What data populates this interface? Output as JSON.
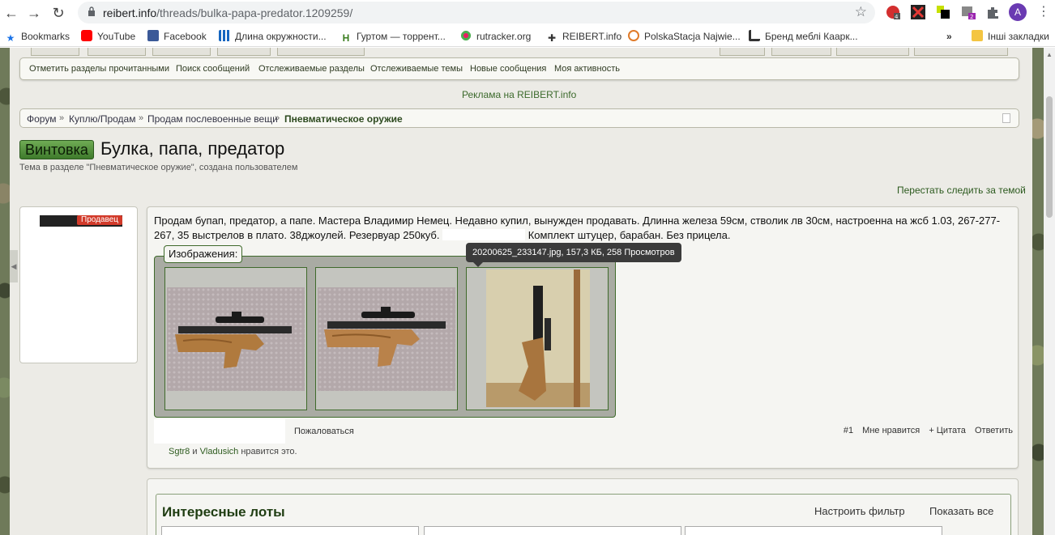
{
  "browser": {
    "url_host": "reibert.info",
    "url_path": "/threads/bulka-papa-predator.1209259/",
    "profile_initial": "A",
    "extension_badges": [
      "4",
      "2"
    ]
  },
  "bookmarks": [
    {
      "label": "Bookmarks",
      "icon": "star-icon",
      "color": "#1a73e8"
    },
    {
      "label": "YouTube",
      "icon": "youtube-icon",
      "color": "#ff0000"
    },
    {
      "label": "Facebook",
      "icon": "facebook-icon",
      "color": "#3b5998"
    },
    {
      "label": "Длина окружности...",
      "icon": "grid-icon",
      "color": "#1565c0"
    },
    {
      "label": "Гуртом — торрент...",
      "icon": "h-icon",
      "color": "#3a7d1f"
    },
    {
      "label": "rutracker.org",
      "icon": "rutracker-icon",
      "color": "#c0392b"
    },
    {
      "label": "REIBERT.info",
      "icon": "cross-icon",
      "color": "#222222"
    },
    {
      "label": "PolskaStacja Najwie...",
      "icon": "polska-icon",
      "color": "#e07b2a"
    },
    {
      "label": "Бренд меблі Каарк...",
      "icon": "furniture-icon",
      "color": "#333333"
    },
    {
      "label": "Інші закладки",
      "icon": "folder-icon",
      "color": "#f4c542"
    }
  ],
  "quicklinks": [
    "Отметить разделы прочитанными",
    "Поиск сообщений",
    "Отслеживаемые разделы",
    "Отслеживаемые темы",
    "Новые сообщения",
    "Моя активность"
  ],
  "ad_text": "Реклама на REIBERT.info",
  "breadcrumb": [
    "Форум",
    "Куплю/Продам",
    "Продам послевоенные вещи",
    "Пневматическое оружие"
  ],
  "thread": {
    "prefix": "Винтовка",
    "title": "Булка, папа, предатор",
    "subtitle": "Тема в разделе \"Пневматическое оружие\", создана пользователем",
    "unwatch": "Перестать следить за темой"
  },
  "user": {
    "badge": "Продавец"
  },
  "post": {
    "text_part1": "Продам бупап, предатор, а папе. Мастера Владимир Немец. Недавно купил, вынужден продавать. Длинна железа 59см, стволик лв 30см, настроенна на жсб 1.03, 267-277-267, 35 выстрелов в плато. 38джоулей. Резервуар 250куб.",
    "text_part2": "Комплект штуцер, барабан. Без прицела.",
    "images_label": "Изображения:",
    "tooltip": "20200625_233147.jpg, 157,3 КБ, 258 Просмотров",
    "report": "Пожаловаться",
    "post_number": "#1",
    "like": "Мне нравится",
    "quote": "+ Цитата",
    "reply": "Ответить",
    "likes_user1": "Sgtr8",
    "likes_and": "и",
    "likes_user2": "Vladusich",
    "likes_suffix": "нравится это."
  },
  "lots": {
    "title": "Интересные лоты",
    "filter": "Настроить фильтр",
    "show_all": "Показать все"
  },
  "colors": {
    "accent_green": "#3e7a2b",
    "link_green": "#2c5a1e",
    "tooltip_bg": "#3b3b3b"
  }
}
